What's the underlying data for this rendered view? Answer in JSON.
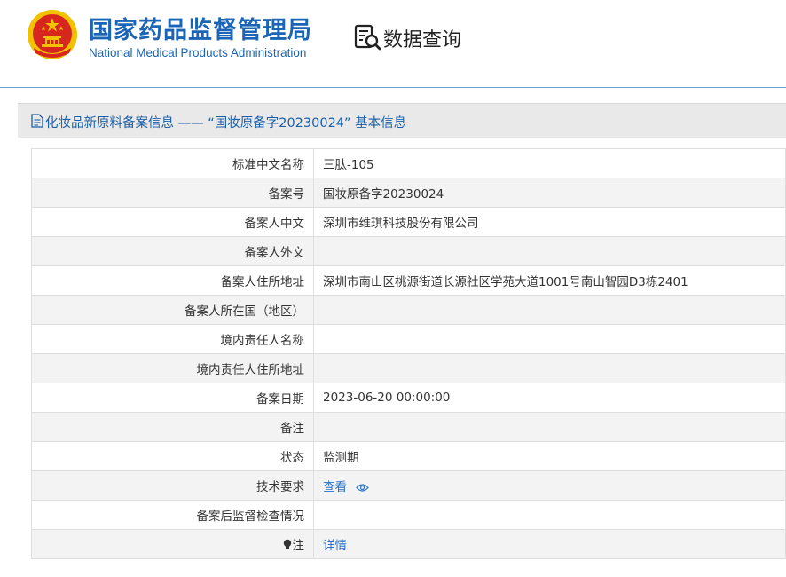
{
  "header": {
    "brand_cn": "国家药品监督管理局",
    "brand_en": "National Medical Products Administration",
    "query_title": "数据查询"
  },
  "section": {
    "title": "化妆品新原料备案信息 —— “国妆原备字20230024” 基本信息"
  },
  "rows": [
    {
      "label": "标准中文名称",
      "value": "三肽-105"
    },
    {
      "label": "备案号",
      "value": "国妆原备字20230024"
    },
    {
      "label": "备案人中文",
      "value": "深圳市维琪科技股份有限公司"
    },
    {
      "label": "备案人外文",
      "value": ""
    },
    {
      "label": "备案人住所地址",
      "value": "深圳市南山区桃源街道长源社区学苑大道1001号南山智园D3栋2401"
    },
    {
      "label": "备案人所在国（地区）",
      "value": ""
    },
    {
      "label": "境内责任人名称",
      "value": ""
    },
    {
      "label": "境内责任人住所地址",
      "value": ""
    },
    {
      "label": "备案日期",
      "value": "2023-06-20 00:00:00"
    },
    {
      "label": "备注",
      "value": ""
    },
    {
      "label": "状态",
      "value": "监测期"
    },
    {
      "label": "技术要求",
      "value": "查看"
    },
    {
      "label": "备案后监督检查情况",
      "value": ""
    },
    {
      "label": "注",
      "value": "详情"
    }
  ],
  "colors": {
    "brand_blue": "#1b64b6",
    "link_blue": "#2a72c7",
    "emblem_red": "#d7261e",
    "emblem_gold": "#f2c200"
  },
  "icons": [
    "national-emblem-icon",
    "data-query-icon",
    "document-icon",
    "eye-icon",
    "lightbulb-icon"
  ]
}
